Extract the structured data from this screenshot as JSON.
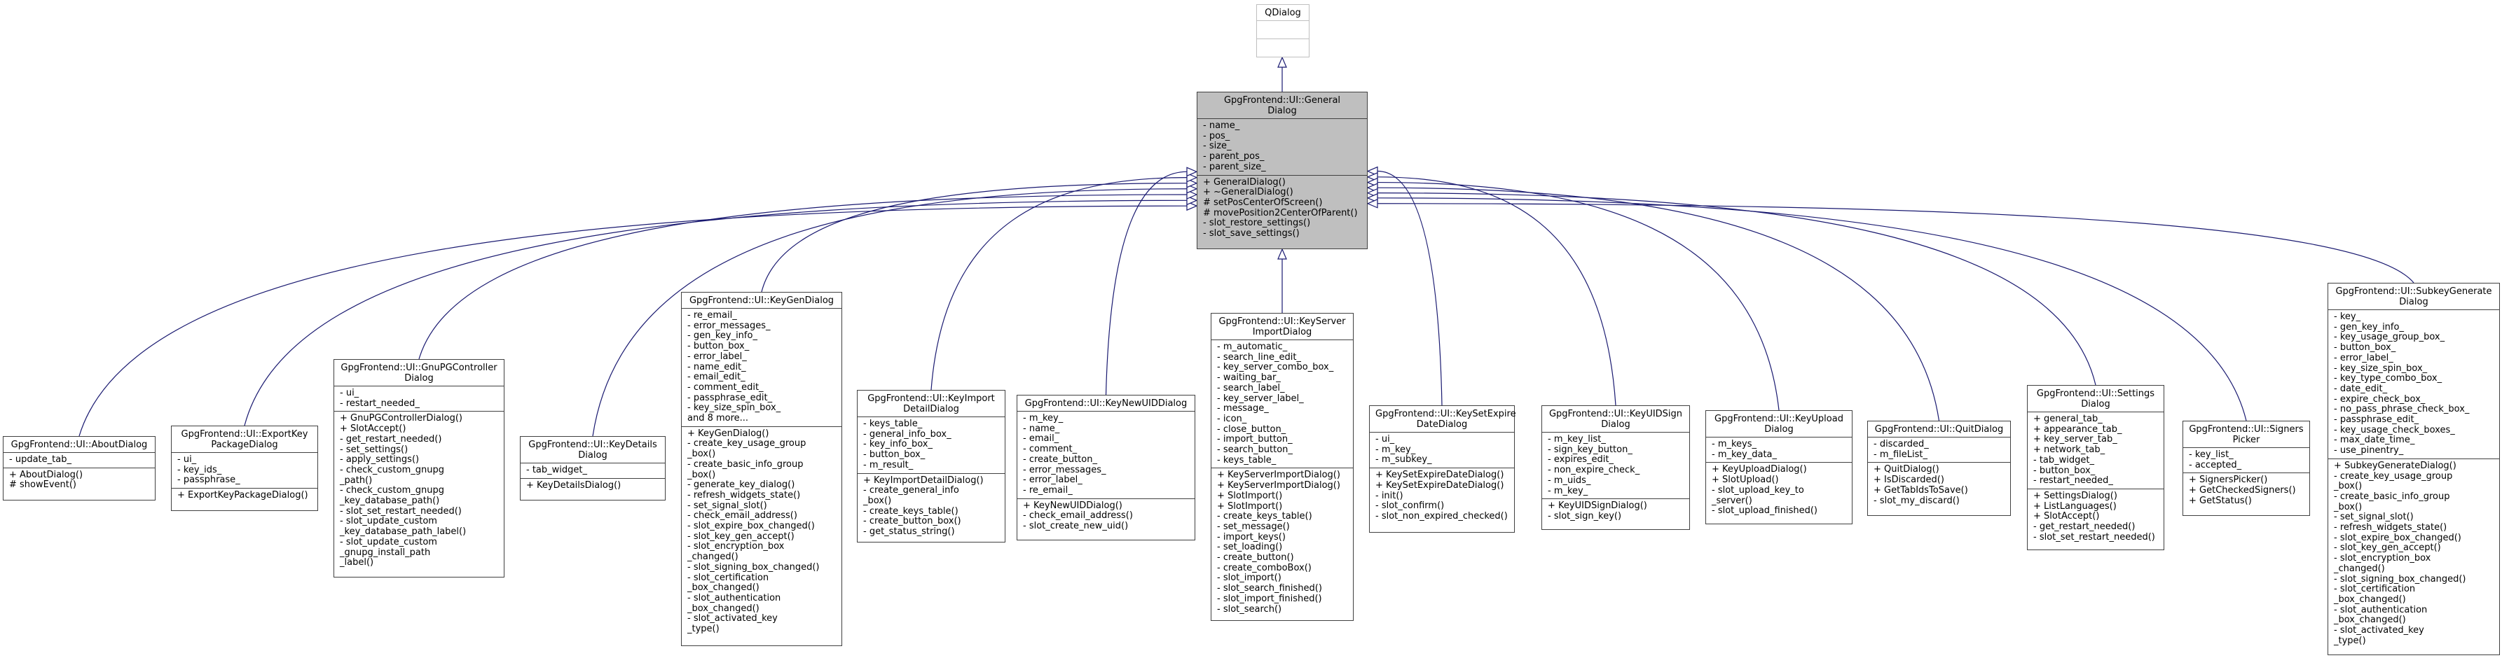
{
  "diagram": {
    "edge_color": "#191970",
    "root": {
      "id": "qdialog",
      "name": "QDialog",
      "attributes": [],
      "methods": []
    },
    "focus": {
      "id": "generaldialog",
      "name": "GpgFrontend::UI::General\nDialog",
      "attributes": [
        "- name_",
        "- pos_",
        "- size_",
        "- parent_pos_",
        "- parent_size_"
      ],
      "methods": [
        "+ GeneralDialog()",
        "+ ~GeneralDialog()",
        "# setPosCenterOfScreen()",
        "# movePosition2CenterOfParent()",
        "- slot_restore_settings()",
        "- slot_save_settings()"
      ]
    },
    "children": [
      {
        "id": "aboutdialog",
        "name": "GpgFrontend::UI::AboutDialog",
        "attributes": [
          "- update_tab_"
        ],
        "methods": [
          "+ AboutDialog()",
          "# showEvent()"
        ]
      },
      {
        "id": "exportkeypackagedialog",
        "name": "GpgFrontend::UI::ExportKey\nPackageDialog",
        "attributes": [
          "- ui_",
          "- key_ids_",
          "- passphrase_"
        ],
        "methods": [
          "+ ExportKeyPackageDialog()"
        ]
      },
      {
        "id": "gnupgcontrollerdialog",
        "name": "GpgFrontend::UI::GnuPGController\nDialog",
        "attributes": [
          "- ui_",
          "- restart_needed_"
        ],
        "methods": [
          "+ GnuPGControllerDialog()",
          "+ SlotAccept()",
          "- get_restart_needed()",
          "- set_settings()",
          "- apply_settings()",
          "- check_custom_gnupg\n_path()",
          "- check_custom_gnupg\n_key_database_path()",
          "- slot_set_restart_needed()",
          "- slot_update_custom\n_key_database_path_label()",
          "- slot_update_custom\n_gnupg_install_path\n_label()"
        ]
      },
      {
        "id": "keydetailsdialog",
        "name": "GpgFrontend::UI::KeyDetails\nDialog",
        "attributes": [
          "- tab_widget_"
        ],
        "methods": [
          "+ KeyDetailsDialog()"
        ]
      },
      {
        "id": "keygendialog",
        "name": "GpgFrontend::UI::KeyGenDialog",
        "attributes": [
          "- re_email_",
          "- error_messages_",
          "- gen_key_info_",
          "- button_box_",
          "- error_label_",
          "- name_edit_",
          "- email_edit_",
          "- comment_edit_",
          "- passphrase_edit_",
          "- key_size_spin_box_",
          "and 8 more..."
        ],
        "methods": [
          "+ KeyGenDialog()",
          "- create_key_usage_group\n_box()",
          "- create_basic_info_group\n_box()",
          "- generate_key_dialog()",
          "- refresh_widgets_state()",
          "- set_signal_slot()",
          "- check_email_address()",
          "- slot_expire_box_changed()",
          "- slot_key_gen_accept()",
          "- slot_encryption_box\n_changed()",
          "- slot_signing_box_changed()",
          "- slot_certification\n_box_changed()",
          "- slot_authentication\n_box_changed()",
          "- slot_activated_key\n_type()"
        ]
      },
      {
        "id": "keyimportdetaildialog",
        "name": "GpgFrontend::UI::KeyImport\nDetailDialog",
        "attributes": [
          "- keys_table_",
          "- general_info_box_",
          "- key_info_box_",
          "- button_box_",
          "- m_result_"
        ],
        "methods": [
          "+ KeyImportDetailDialog()",
          "- create_general_info\n_box()",
          "- create_keys_table()",
          "- create_button_box()",
          "- get_status_string()"
        ]
      },
      {
        "id": "keynewuiddialog",
        "name": "GpgFrontend::UI::KeyNewUIDDialog",
        "attributes": [
          "- m_key_",
          "- name_",
          "- email_",
          "- comment_",
          "- create_button_",
          "- error_messages_",
          "- error_label_",
          "- re_email_"
        ],
        "methods": [
          "+ KeyNewUIDDialog()",
          "- check_email_address()",
          "- slot_create_new_uid()"
        ]
      },
      {
        "id": "keyserverimportdialog",
        "name": "GpgFrontend::UI::KeyServer\nImportDialog",
        "attributes": [
          "- m_automatic_",
          "- search_line_edit_",
          "- key_server_combo_box_",
          "- waiting_bar_",
          "- search_label_",
          "- key_server_label_",
          "- message_",
          "- icon_",
          "- close_button_",
          "- import_button_",
          "- search_button_",
          "- keys_table_"
        ],
        "methods": [
          "+ KeyServerImportDialog()",
          "+ KeyServerImportDialog()",
          "+ SlotImport()",
          "+ SlotImport()",
          "- create_keys_table()",
          "- set_message()",
          "- import_keys()",
          "- set_loading()",
          "- create_button()",
          "- create_comboBox()",
          "- slot_import()",
          "- slot_search_finished()",
          "- slot_import_finished()",
          "- slot_search()"
        ]
      },
      {
        "id": "keysetexpiredatedialog",
        "name": "GpgFrontend::UI::KeySetExpire\nDateDialog",
        "attributes": [
          "- ui_",
          "- m_key_",
          "- m_subkey_"
        ],
        "methods": [
          "+ KeySetExpireDateDialog()",
          "+ KeySetExpireDateDialog()",
          "- init()",
          "- slot_confirm()",
          "- slot_non_expired_checked()"
        ]
      },
      {
        "id": "keyuidsigndialog",
        "name": "GpgFrontend::UI::KeyUIDSign\nDialog",
        "attributes": [
          "- m_key_list_",
          "- sign_key_button_",
          "- expires_edit_",
          "- non_expire_check_",
          "- m_uids_",
          "- m_key_"
        ],
        "methods": [
          "+ KeyUIDSignDialog()",
          "- slot_sign_key()"
        ]
      },
      {
        "id": "keyuploaddialog",
        "name": "GpgFrontend::UI::KeyUpload\nDialog",
        "attributes": [
          "- m_keys_",
          "- m_key_data_"
        ],
        "methods": [
          "+ KeyUploadDialog()",
          "+ SlotUpload()",
          "- slot_upload_key_to\n_server()",
          "- slot_upload_finished()"
        ]
      },
      {
        "id": "quitdialog",
        "name": "GpgFrontend::UI::QuitDialog",
        "attributes": [
          "- discarded_",
          "- m_fileList_"
        ],
        "methods": [
          "+ QuitDialog()",
          "+ IsDiscarded()",
          "+ GetTabIdsToSave()",
          "- slot_my_discard()"
        ]
      },
      {
        "id": "settingsdialog",
        "name": "GpgFrontend::UI::Settings\nDialog",
        "attributes": [
          "+ general_tab_",
          "+ appearance_tab_",
          "+ key_server_tab_",
          "+ network_tab_",
          "- tab_widget_",
          "- button_box_",
          "- restart_needed_"
        ],
        "methods": [
          "+ SettingsDialog()",
          "+ ListLanguages()",
          "+ SlotAccept()",
          "- get_restart_needed()",
          "- slot_set_restart_needed()"
        ]
      },
      {
        "id": "signerspicker",
        "name": "GpgFrontend::UI::Signers\nPicker",
        "attributes": [
          "- key_list_",
          "- accepted_"
        ],
        "methods": [
          "+ SignersPicker()",
          "+ GetCheckedSigners()",
          "+ GetStatus()"
        ]
      },
      {
        "id": "subkeygeneratedialog",
        "name": "GpgFrontend::UI::SubkeyGenerate\nDialog",
        "attributes": [
          "- key_",
          "- gen_key_info_",
          "- key_usage_group_box_",
          "- button_box_",
          "- error_label_",
          "- key_size_spin_box_",
          "- key_type_combo_box_",
          "- date_edit_",
          "- expire_check_box_",
          "- no_pass_phrase_check_box_",
          "- passphrase_edit_",
          "- key_usage_check_boxes_",
          "- max_date_time_",
          "- use_pinentry_"
        ],
        "methods": [
          "+ SubkeyGenerateDialog()",
          "- create_key_usage_group\n_box()",
          "- create_basic_info_group\n_box()",
          "- set_signal_slot()",
          "- refresh_widgets_state()",
          "- slot_expire_box_changed()",
          "- slot_key_gen_accept()",
          "- slot_encryption_box\n_changed()",
          "- slot_signing_box_changed()",
          "- slot_certification\n_box_changed()",
          "- slot_authentication\n_box_changed()",
          "- slot_activated_key\n_type()"
        ]
      }
    ]
  }
}
